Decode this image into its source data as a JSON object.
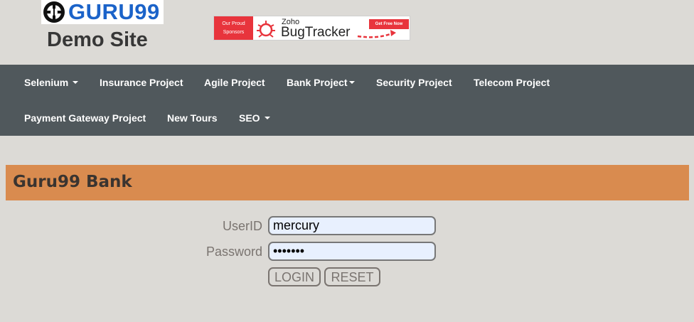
{
  "header": {
    "logo_text": "GURU99",
    "site_title": "Demo Site"
  },
  "sponsor": {
    "tagline_line1": "Our Proud",
    "tagline_line2": "Sponsors",
    "brand_small": "Zoho",
    "brand_large": "BugTracker",
    "cta_label": "Get Free Now"
  },
  "nav": {
    "row1": [
      {
        "label": "Selenium",
        "dropdown": true
      },
      {
        "label": "Insurance Project",
        "dropdown": false
      },
      {
        "label": "Agile Project",
        "dropdown": false
      },
      {
        "label": "Bank Project",
        "dropdown": true
      },
      {
        "label": "Security Project",
        "dropdown": false
      },
      {
        "label": "Telecom Project",
        "dropdown": false
      }
    ],
    "row2": [
      {
        "label": "Payment Gateway Project",
        "dropdown": false
      },
      {
        "label": "New Tours",
        "dropdown": false
      },
      {
        "label": "SEO",
        "dropdown": true
      }
    ]
  },
  "bank": {
    "title": "Guru99 Bank"
  },
  "login": {
    "userid_label": "UserID",
    "userid_value": "mercury",
    "password_label": "Password",
    "password_value": "mercury",
    "login_button": "LOGIN",
    "reset_button": "RESET"
  },
  "colors": {
    "page_bg": "#dcdad6",
    "nav_bg": "#50585c",
    "bank_bar": "#d98b4f",
    "logo_blue": "#1b63c9",
    "sponsor_red": "#e8343c"
  }
}
